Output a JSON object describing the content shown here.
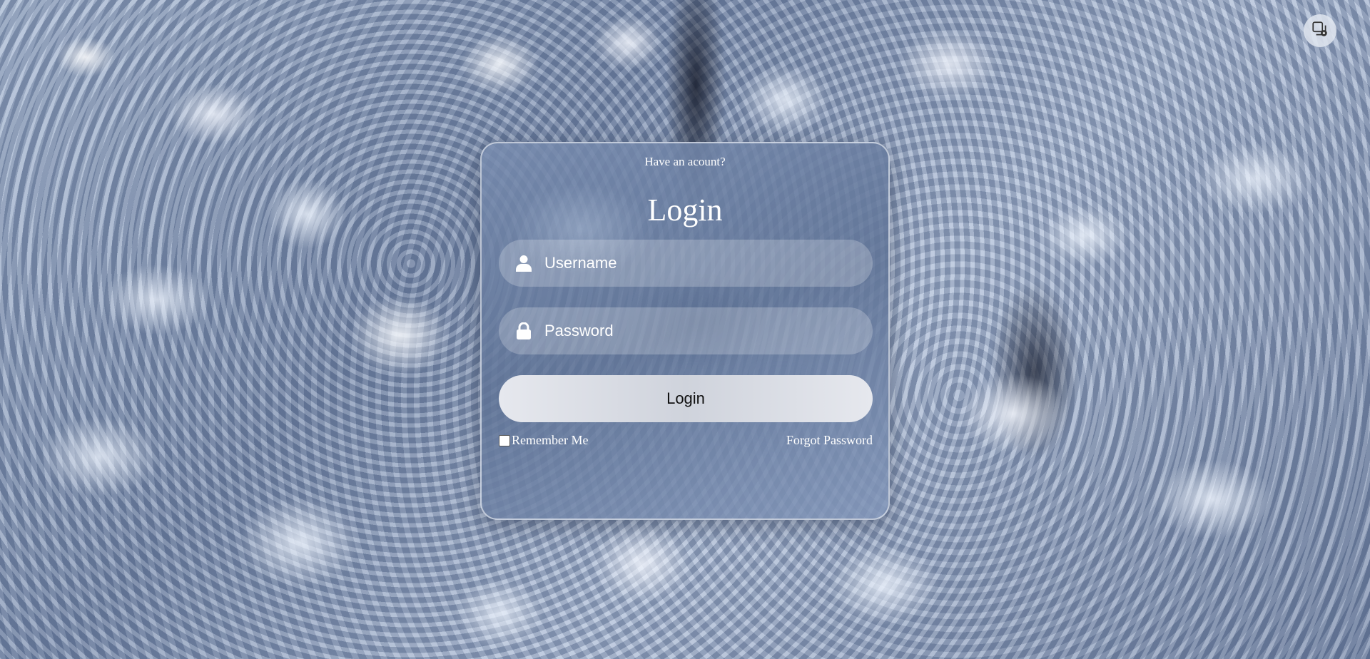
{
  "card": {
    "subtitle": "Have an acount?",
    "title": "Login",
    "username": {
      "placeholder": "Username",
      "icon": "user-icon"
    },
    "password": {
      "placeholder": "Password",
      "icon": "lock-icon"
    },
    "login_label": "Login",
    "remember_label": "Remember Me",
    "remember_checked": false,
    "forgot_label": "Forgot Password"
  },
  "extension": {
    "icon": "copy-search-icon"
  },
  "colors": {
    "text": "#ffffff",
    "button_bg": "#dfe2e9",
    "button_text": "#111111"
  }
}
